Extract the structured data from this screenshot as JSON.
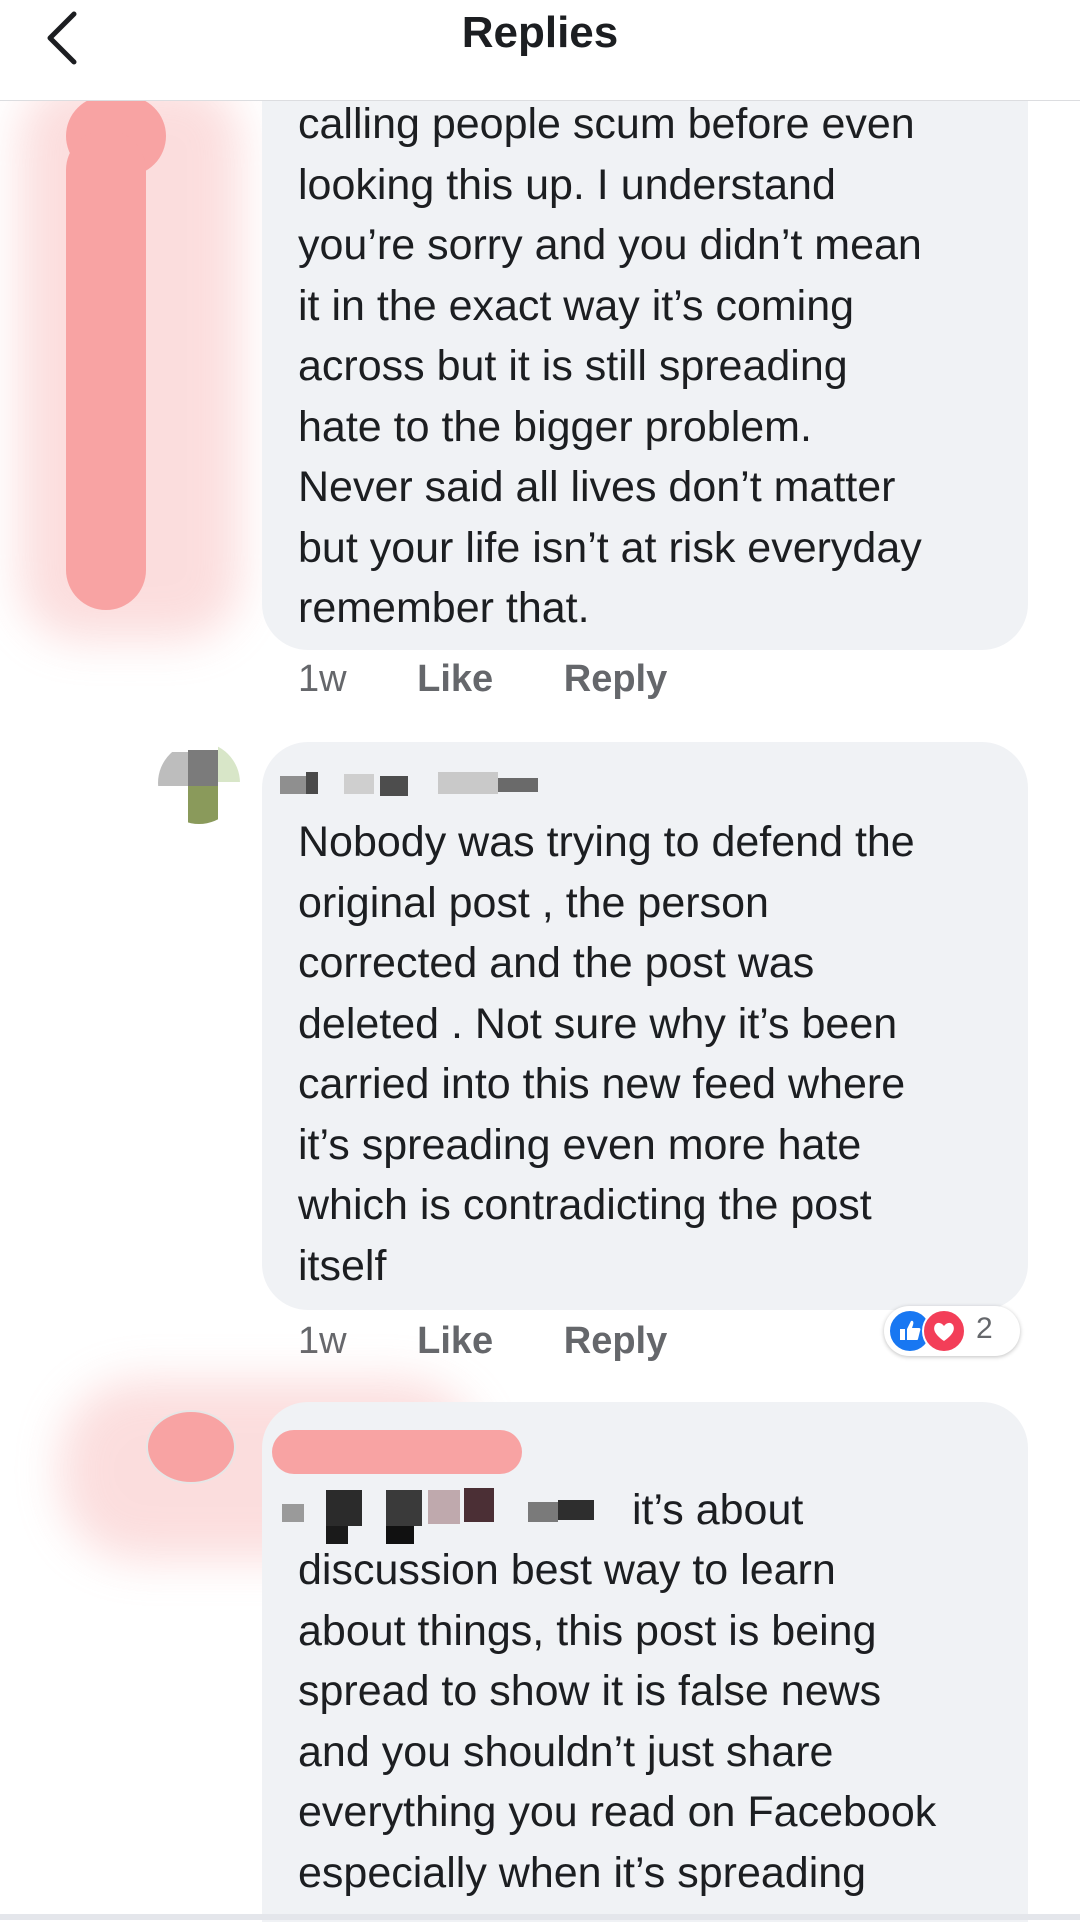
{
  "header": {
    "title": "Replies"
  },
  "comments": [
    {
      "text": "calling people scum before even\nlooking this up. I understand\nyou’re sorry and you didn’t mean\nit in the exact way it’s coming\nacross but it is still spreading\nhate to the bigger problem.\nNever said all lives don’t matter\nbut your life isn’t at risk everyday\nremember that.",
      "time": "1w",
      "like": "Like",
      "reply": "Reply"
    },
    {
      "text": "Nobody was trying to defend the\noriginal post , the person\ncorrected and the post was\ndeleted . Not sure why it’s been\ncarried into this new feed where\nit’s spreading even more hate\nwhich is contradicting the post\nitself",
      "time": "1w",
      "like": "Like",
      "reply": "Reply",
      "reactions": {
        "count": "2",
        "types": [
          "like-icon",
          "love-icon"
        ],
        "colors": {
          "like": "#1877f2",
          "love": "#f33e58"
        }
      }
    },
    {
      "text_first_line": "it’s about",
      "text": "discussion best way to learn\nabout things, this post is being\nspread to show it is false news\nand you shouldn’t just share\neverything you read on Facebook\nespecially when it’s spreading"
    }
  ],
  "colors": {
    "bubble": "#f0f2f5",
    "meta": "#65676b",
    "redaction": "#f5a0a0"
  }
}
